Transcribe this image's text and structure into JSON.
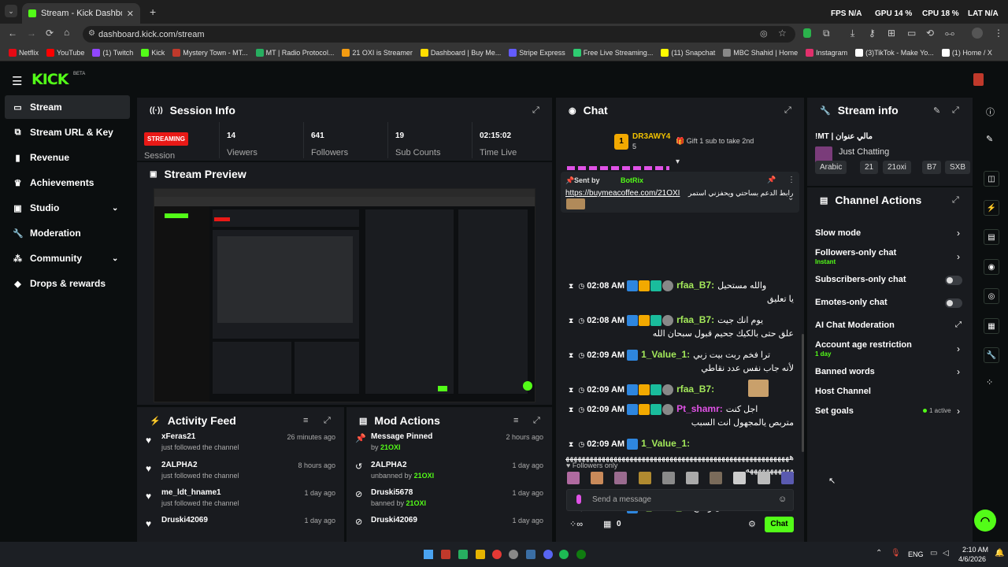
{
  "browser": {
    "tab_title": "Stream - Kick Dashboard",
    "url": "dashboard.kick.com/stream",
    "bookmarks": [
      "Netflix",
      "YouTube",
      "(1) Twitch",
      "Kick",
      "Mystery Town - MT...",
      "MT | Radio Protocol...",
      "21 OXI is Streamer",
      "Dashboard | Buy Me...",
      "Stripe Express",
      "Free Live Streaming...",
      "(11) Snapchat",
      "MBC Shahid | Home",
      "Instagram",
      "(3)TikTok - Make Yo...",
      "(1) Home / X"
    ],
    "overlay": {
      "fps": "FPS",
      "fps_val": "N/A",
      "gpu": "GPU",
      "gpu_val": "14 %",
      "cpu": "CPU",
      "cpu_val": "18 %",
      "lat": "LAT",
      "lat_val": "N/A"
    }
  },
  "brand": {
    "logo": "KICK",
    "beta": "BETA"
  },
  "sidebar": [
    {
      "label": "Stream",
      "icon": "stream-icon"
    },
    {
      "label": "Stream URL & Key",
      "icon": "link-icon"
    },
    {
      "label": "Revenue",
      "icon": "revenue-icon"
    },
    {
      "label": "Achievements",
      "icon": "trophy-icon"
    },
    {
      "label": "Studio",
      "icon": "studio-icon"
    },
    {
      "label": "Moderation",
      "icon": "wrench-icon"
    },
    {
      "label": "Community",
      "icon": "community-icon"
    },
    {
      "label": "Drops & rewards",
      "icon": "drops-icon"
    }
  ],
  "session": {
    "title": "Session Info",
    "status": "STREAMING",
    "status_label": "Session",
    "stats": [
      {
        "value": "14",
        "label": "Viewers"
      },
      {
        "value": "641",
        "label": "Followers"
      },
      {
        "value": "19",
        "label": "Sub Counts"
      },
      {
        "value": "02:15:02",
        "label": "Time Live"
      }
    ]
  },
  "preview": {
    "title": "Stream Preview"
  },
  "activity": {
    "title": "Activity Feed",
    "items": [
      {
        "user": "xFeras21",
        "action": "just followed the channel",
        "time": "26 minutes ago"
      },
      {
        "user": "2ALPHA2",
        "action": "just followed the channel",
        "time": "8 hours ago"
      },
      {
        "user": "me_ldt_hname1",
        "action": "just followed the channel",
        "time": "1 day ago"
      },
      {
        "user": "Druski42069",
        "action": "",
        "time": "1 day ago"
      }
    ]
  },
  "modactions": {
    "title": "Mod Actions",
    "items": [
      {
        "title": "Message Pinned",
        "sub": "by ",
        "by": "21OXI",
        "time": "2 hours ago"
      },
      {
        "title": "2ALPHA2",
        "sub": "unbanned by ",
        "by": "21OXI",
        "time": "1 day ago"
      },
      {
        "title": "Druski5678",
        "sub": "banned by ",
        "by": "21OXI",
        "time": "1 day ago"
      },
      {
        "title": "Druski42069",
        "sub": "",
        "by": "",
        "time": "1 day ago"
      }
    ]
  },
  "chat": {
    "title": "Chat",
    "top_gifter": {
      "rank": "1",
      "name": "DR3AWY4",
      "count": "5"
    },
    "gift_prompt": "Gift 1 sub to take 2nd",
    "pinned": {
      "sent_by": "Sent by",
      "bot": "BotRix",
      "url": "https://buymeacoffee.com/21OXI",
      "text": "رابط الدعم بساحتي ويحفزني استمر"
    },
    "messages": [
      {
        "time": "02:08 AM",
        "user": "rfaa_B7:",
        "text": "والله مستحيل",
        "text2": "يا تعليق",
        "color": "#a3e85a"
      },
      {
        "time": "02:08 AM",
        "user": "rfaa_B7:",
        "text": "يوم انك جيت",
        "text2": "علق حتى بالكيك جحيم قبول سبحان الله",
        "color": "#a3e85a"
      },
      {
        "time": "02:09 AM",
        "user": "1_Value_1:",
        "text": "ترا فخم ربت بيت زبي",
        "text2": "لأنه جاب نفس عدد نقاطي",
        "color": "#a3e85a"
      },
      {
        "time": "02:09 AM",
        "user": "rfaa_B7:",
        "text": "",
        "text2": "",
        "color": "#a3e85a"
      },
      {
        "time": "02:09 AM",
        "user": "Pt_shamr:",
        "text": "اجل كنت",
        "text2": "متربص يالمجهول انت السبب",
        "color": "#e052e6"
      },
      {
        "time": "02:09 AM",
        "user": "1_Value_1:",
        "text": "",
        "text2": "ههههههههههههههههههههههههههههههههههههههههههههههههههههههههههههههههههههه",
        "color": "#a3e85a"
      },
      {
        "time": "02:09 AM",
        "user": "1_Value_1:",
        "text": "تقفل وتفتح",
        "text2": "",
        "color": "#a3e85a"
      }
    ],
    "mode": "Followers only",
    "input_placeholder": "Send a message",
    "count": "0",
    "send_label": "Chat"
  },
  "streaminfo": {
    "title": "Stream info",
    "stream_title": "!MT | مالي عنوان",
    "category": "Just Chatting",
    "tags": [
      "Arabic",
      "21",
      "21oxi",
      "B7",
      "SXB"
    ]
  },
  "channelactions": {
    "title": "Channel Actions",
    "items": [
      {
        "label": "Slow mode",
        "sub": "",
        "control": "chevron"
      },
      {
        "label": "Followers-only chat",
        "sub": "Instant",
        "control": "chevron"
      },
      {
        "label": "Subscribers-only chat",
        "sub": "",
        "control": "toggle"
      },
      {
        "label": "Emotes-only chat",
        "sub": "",
        "control": "toggle"
      },
      {
        "label": "AI Chat Moderation",
        "sub": "",
        "control": "external"
      },
      {
        "label": "Account age restriction",
        "sub": "1 day",
        "control": "chevron"
      },
      {
        "label": "Banned words",
        "sub": "",
        "control": "chevron"
      },
      {
        "label": "Host Channel",
        "sub": "",
        "control": "none"
      },
      {
        "label": "Set goals",
        "sub": "",
        "badge": "1 active",
        "control": "chevron"
      }
    ]
  },
  "taskbar": {
    "lang": "ENG",
    "time": "2:10 AM",
    "date": "4/6/2026"
  },
  "colors": {
    "accent": "#53fc18",
    "panel": "#191b1f",
    "bg": "#0b0e0f",
    "streaming": "#e91916"
  }
}
